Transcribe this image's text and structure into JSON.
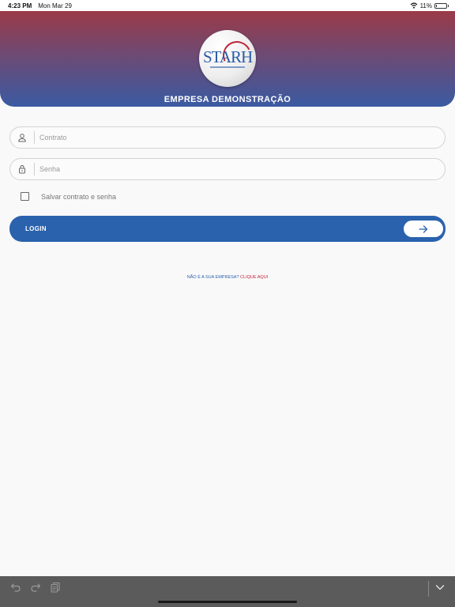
{
  "status": {
    "time": "4:23 PM",
    "date": "Mon Mar 29",
    "battery": "11%",
    "battery_level": 0.11
  },
  "header": {
    "logo_text": "STARH",
    "company_name": "EMPRESA DEMONSTRAÇÃO"
  },
  "form": {
    "contract_placeholder": "Contrato",
    "contract_value": "",
    "password_placeholder": "Senha",
    "password_value": "",
    "remember_label": "Salvar contrato e senha",
    "remember_checked": false,
    "login_label": "LOGIN"
  },
  "footer_link": {
    "question": "NÃO É A SUA EMPRESA?",
    "action": "CLIQUE AQUI"
  },
  "keyboard_toolbar": {
    "icons": [
      "undo-icon",
      "redo-icon",
      "paste-icon",
      "dismiss-keyboard-icon"
    ]
  },
  "colors": {
    "primary": "#2a62ad",
    "accent": "#c0243a",
    "header_top": "#9b3a47",
    "header_bottom": "#3a5aa2"
  }
}
